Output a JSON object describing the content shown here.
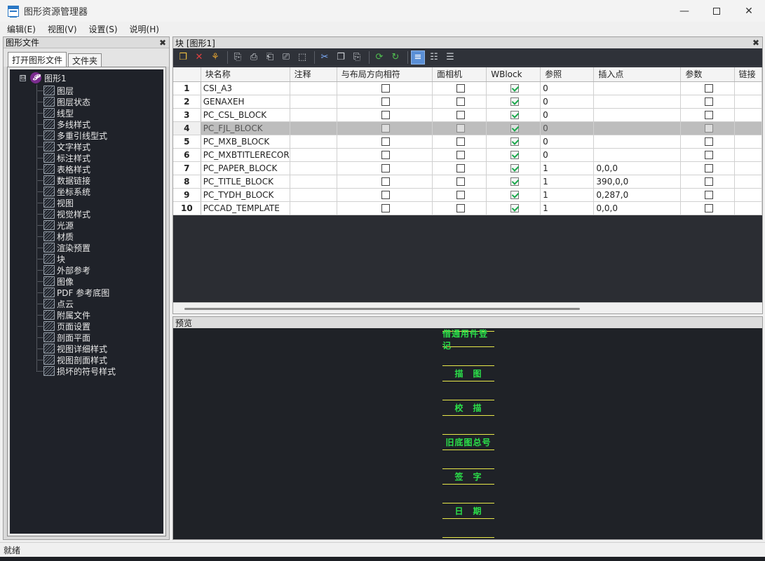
{
  "window": {
    "title": "图形资源管理器",
    "minimize_icon": "minimize-icon",
    "maximize_icon": "maximize-icon",
    "close_icon": "close-icon"
  },
  "menu": [
    {
      "label": "编辑(E)"
    },
    {
      "label": "视图(V)"
    },
    {
      "label": "设置(S)"
    },
    {
      "label": "说明(H)"
    }
  ],
  "left_panel": {
    "title": "图形文件",
    "tabs": [
      {
        "label": "打开图形文件"
      },
      {
        "label": "文件夹"
      }
    ],
    "root": {
      "label": "图形1",
      "expander": "⊟"
    },
    "items": [
      {
        "label": "图层"
      },
      {
        "label": "图层状态"
      },
      {
        "label": "线型"
      },
      {
        "label": "多线样式"
      },
      {
        "label": "多重引线型式"
      },
      {
        "label": "文字样式"
      },
      {
        "label": "标注样式"
      },
      {
        "label": "表格样式"
      },
      {
        "label": "数据链接"
      },
      {
        "label": "坐标系统"
      },
      {
        "label": "视图"
      },
      {
        "label": "视觉样式"
      },
      {
        "label": "光源"
      },
      {
        "label": "材质"
      },
      {
        "label": "渲染预置"
      },
      {
        "label": "块"
      },
      {
        "label": "外部参考"
      },
      {
        "label": "图像"
      },
      {
        "label": "PDF 参考底图"
      },
      {
        "label": "点云"
      },
      {
        "label": "附属文件"
      },
      {
        "label": "页面设置"
      },
      {
        "label": "剖面平面"
      },
      {
        "label": "视图详细样式"
      },
      {
        "label": "视图剖面样式"
      },
      {
        "label": "损坏的符号样式"
      }
    ]
  },
  "block_panel": {
    "title": "块 [图形1]",
    "toolbar_icons": [
      "new-icon",
      "delete-icon",
      "purge-icon",
      "copy-to-icon",
      "insert-icon",
      "export-icon",
      "rename-icon",
      "attach-icon",
      "cut-icon",
      "copy-icon",
      "paste-icon",
      "refresh-icon",
      "sync-icon",
      "list-view-icon",
      "thumbnail-view-icon",
      "detail-view-icon"
    ],
    "columns": [
      "块名称",
      "注释",
      "与布局方向相符",
      "面相机",
      "WBlock",
      "参照",
      "插入点",
      "参数",
      "链接"
    ],
    "rows": [
      {
        "num": "1",
        "name": "CSI_A3",
        "note": "",
        "layout": false,
        "camera": false,
        "wblock": true,
        "ref": "0",
        "insert": "",
        "param": false
      },
      {
        "num": "2",
        "name": "GENAXEH",
        "note": "",
        "layout": false,
        "camera": false,
        "wblock": true,
        "ref": "0",
        "insert": "",
        "param": false
      },
      {
        "num": "3",
        "name": "PC_CSL_BLOCK",
        "note": "",
        "layout": false,
        "camera": false,
        "wblock": true,
        "ref": "0",
        "insert": "",
        "param": false
      },
      {
        "num": "4",
        "name": "PC_FJL_BLOCK",
        "note": "",
        "layout": false,
        "camera": false,
        "wblock": true,
        "ref": "0",
        "insert": "",
        "param": false,
        "selected": true
      },
      {
        "num": "5",
        "name": "PC_MXB_BLOCK",
        "note": "",
        "layout": false,
        "camera": false,
        "wblock": true,
        "ref": "0",
        "insert": "",
        "param": false
      },
      {
        "num": "6",
        "name": "PC_MXBTITLERECOR",
        "note": "",
        "layout": false,
        "camera": false,
        "wblock": true,
        "ref": "0",
        "insert": "",
        "param": false
      },
      {
        "num": "7",
        "name": "PC_PAPER_BLOCK",
        "note": "",
        "layout": false,
        "camera": false,
        "wblock": true,
        "ref": "1",
        "insert": "0,0,0",
        "param": false
      },
      {
        "num": "8",
        "name": "PC_TITLE_BLOCK",
        "note": "",
        "layout": false,
        "camera": false,
        "wblock": true,
        "ref": "1",
        "insert": "390,0,0",
        "param": false
      },
      {
        "num": "9",
        "name": "PC_TYDH_BLOCK",
        "note": "",
        "layout": false,
        "camera": false,
        "wblock": true,
        "ref": "1",
        "insert": "0,287,0",
        "param": false
      },
      {
        "num": "10",
        "name": "PCCAD_TEMPLATE",
        "note": "",
        "layout": false,
        "camera": false,
        "wblock": true,
        "ref": "1",
        "insert": "0,0,0",
        "param": false
      }
    ]
  },
  "preview_panel": {
    "title": "预览",
    "labels": [
      "借通用件登记",
      "描　图",
      "校　描",
      "旧底图总号",
      "签　字",
      "日　期"
    ],
    "text_color": "#2be04a",
    "line_color": "#e8e84a"
  },
  "status": {
    "text": "就绪"
  }
}
